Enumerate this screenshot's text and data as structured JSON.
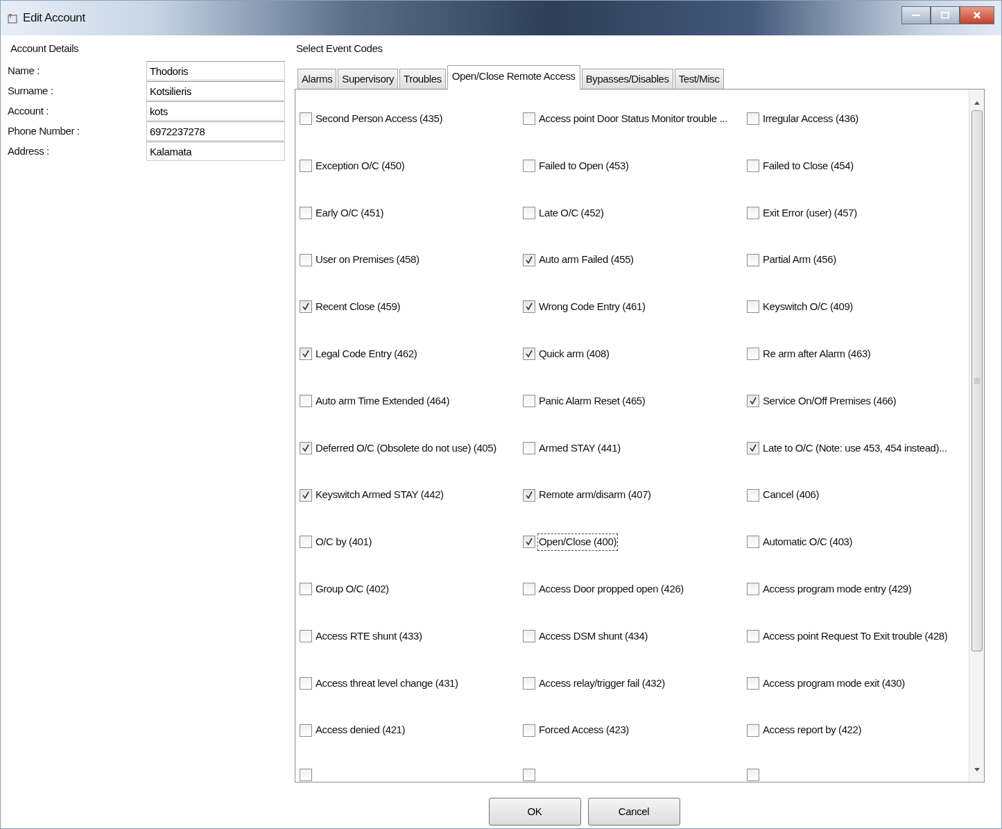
{
  "window": {
    "title": "Edit Account"
  },
  "account_details": {
    "heading": "Account Details",
    "fields": [
      {
        "label": "Name :",
        "value": "Thodoris"
      },
      {
        "label": "Surname :",
        "value": "Kotsilieris"
      },
      {
        "label": "Account :",
        "value": "kots"
      },
      {
        "label": "Phone Number :",
        "value": "6972237278"
      },
      {
        "label": "Address :",
        "value": "Kalamata"
      }
    ]
  },
  "event_codes": {
    "heading": "Select Event Codes",
    "tabs": [
      {
        "label": "Alarms",
        "selected": false
      },
      {
        "label": "Supervisory",
        "selected": false
      },
      {
        "label": "Troubles",
        "selected": false
      },
      {
        "label": "Open/Close Remote Access",
        "selected": true
      },
      {
        "label": "Bypasses/Disables",
        "selected": false
      },
      {
        "label": "Test/Misc",
        "selected": false
      }
    ],
    "items": [
      {
        "label": "Second Person Access (435)",
        "checked": false,
        "focused": false
      },
      {
        "label": "Access point Door Status Monitor trouble ...",
        "checked": false,
        "focused": false
      },
      {
        "label": "Irregular Access (436)",
        "checked": false,
        "focused": false
      },
      {
        "label": "Exception O/C (450)",
        "checked": false,
        "focused": false
      },
      {
        "label": "Failed to Open (453)",
        "checked": false,
        "focused": false
      },
      {
        "label": "Failed to Close (454)",
        "checked": false,
        "focused": false
      },
      {
        "label": "Early O/C (451)",
        "checked": false,
        "focused": false
      },
      {
        "label": "Late O/C (452)",
        "checked": false,
        "focused": false
      },
      {
        "label": "Exit Error (user) (457)",
        "checked": false,
        "focused": false
      },
      {
        "label": "User on Premises (458)",
        "checked": false,
        "focused": false
      },
      {
        "label": "Auto arm Failed (455)",
        "checked": true,
        "focused": false
      },
      {
        "label": "Partial Arm (456)",
        "checked": false,
        "focused": false
      },
      {
        "label": "Recent Close (459)",
        "checked": true,
        "focused": false
      },
      {
        "label": "Wrong Code Entry (461)",
        "checked": true,
        "focused": false
      },
      {
        "label": "Keyswitch O/C (409)",
        "checked": false,
        "focused": false
      },
      {
        "label": "Legal Code Entry (462)",
        "checked": true,
        "focused": false
      },
      {
        "label": "Quick arm (408)",
        "checked": true,
        "focused": false
      },
      {
        "label": "Re arm after Alarm (463)",
        "checked": false,
        "focused": false
      },
      {
        "label": "Auto arm Time Extended (464)",
        "checked": false,
        "focused": false
      },
      {
        "label": "Panic Alarm Reset (465)",
        "checked": false,
        "focused": false
      },
      {
        "label": "Service On/Off Premises (466)",
        "checked": true,
        "focused": false
      },
      {
        "label": "Deferred O/C (Obsolete do not use) (405)",
        "checked": true,
        "focused": false
      },
      {
        "label": "Armed STAY (441)",
        "checked": false,
        "focused": false
      },
      {
        "label": "Late to O/C (Note: use 453, 454 instead)...",
        "checked": true,
        "focused": false
      },
      {
        "label": "Keyswitch Armed STAY (442)",
        "checked": true,
        "focused": false
      },
      {
        "label": "Remote arm/disarm (407)",
        "checked": true,
        "focused": false
      },
      {
        "label": "Cancel (406)",
        "checked": false,
        "focused": false
      },
      {
        "label": "O/C by (401)",
        "checked": false,
        "focused": false
      },
      {
        "label": "Open/Close (400)",
        "checked": true,
        "focused": true
      },
      {
        "label": "Automatic O/C (403)",
        "checked": false,
        "focused": false
      },
      {
        "label": "Group O/C (402)",
        "checked": false,
        "focused": false
      },
      {
        "label": "Access Door propped open (426)",
        "checked": false,
        "focused": false
      },
      {
        "label": "Access program mode entry (429)",
        "checked": false,
        "focused": false
      },
      {
        "label": "Access RTE shunt (433)",
        "checked": false,
        "focused": false
      },
      {
        "label": "Access DSM shunt (434)",
        "checked": false,
        "focused": false
      },
      {
        "label": "Access point Request To Exit trouble (428)",
        "checked": false,
        "focused": false
      },
      {
        "label": "Access threat level change (431)",
        "checked": false,
        "focused": false
      },
      {
        "label": "Access relay/trigger fail (432)",
        "checked": false,
        "focused": false
      },
      {
        "label": "Access program mode exit (430)",
        "checked": false,
        "focused": false
      },
      {
        "label": "Access denied (421)",
        "checked": false,
        "focused": false
      },
      {
        "label": "Forced Access (423)",
        "checked": false,
        "focused": false
      },
      {
        "label": "Access report by (422)",
        "checked": false,
        "focused": false
      }
    ],
    "cut_off_items": [
      {
        "checked": false
      },
      {
        "checked": false
      },
      {
        "checked": false
      }
    ]
  },
  "buttons": [
    {
      "label": "OK"
    },
    {
      "label": "Cancel"
    }
  ]
}
